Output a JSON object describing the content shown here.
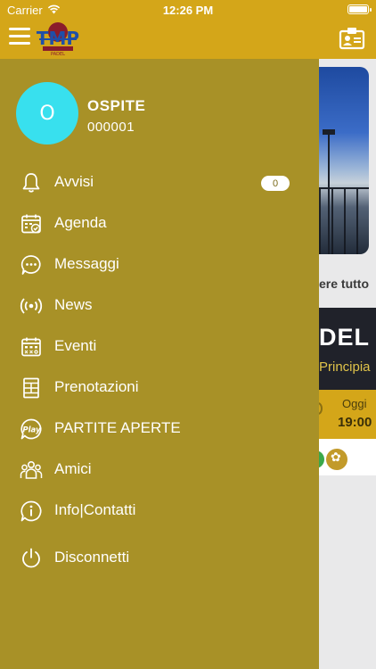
{
  "status_bar": {
    "carrier": "Carrier",
    "time": "12:26 PM"
  },
  "header": {
    "logo_text": "PADEL"
  },
  "profile": {
    "initial": "O",
    "name": "OSPITE",
    "code": "000001"
  },
  "menu": [
    {
      "label": "Avvisi",
      "icon": "bell-icon",
      "badge": "0"
    },
    {
      "label": "Agenda",
      "icon": "calendar-check-icon"
    },
    {
      "label": "Messaggi",
      "icon": "chat-bubble-icon"
    },
    {
      "label": "News",
      "icon": "broadcast-icon"
    },
    {
      "label": "Eventi",
      "icon": "calendar-grid-icon"
    },
    {
      "label": "Prenotazioni",
      "icon": "court-icon"
    },
    {
      "label": "PARTITE APERTE",
      "icon": "play-badge-icon"
    },
    {
      "label": "Amici",
      "icon": "group-icon"
    },
    {
      "label": "Info|Contatti",
      "icon": "info-bubble-icon"
    },
    {
      "label": "Disconnetti",
      "icon": "power-icon"
    }
  ],
  "background": {
    "see_all": "ere tutto",
    "card_title": "DEL",
    "card_subtitle": "Principia",
    "card_day": "Oggi",
    "card_time": "19:00"
  },
  "colors": {
    "drawer": "#a89127",
    "header": "#d4a619",
    "avatar": "#38e0ee",
    "overlay_bg": "#e9e9ea"
  }
}
